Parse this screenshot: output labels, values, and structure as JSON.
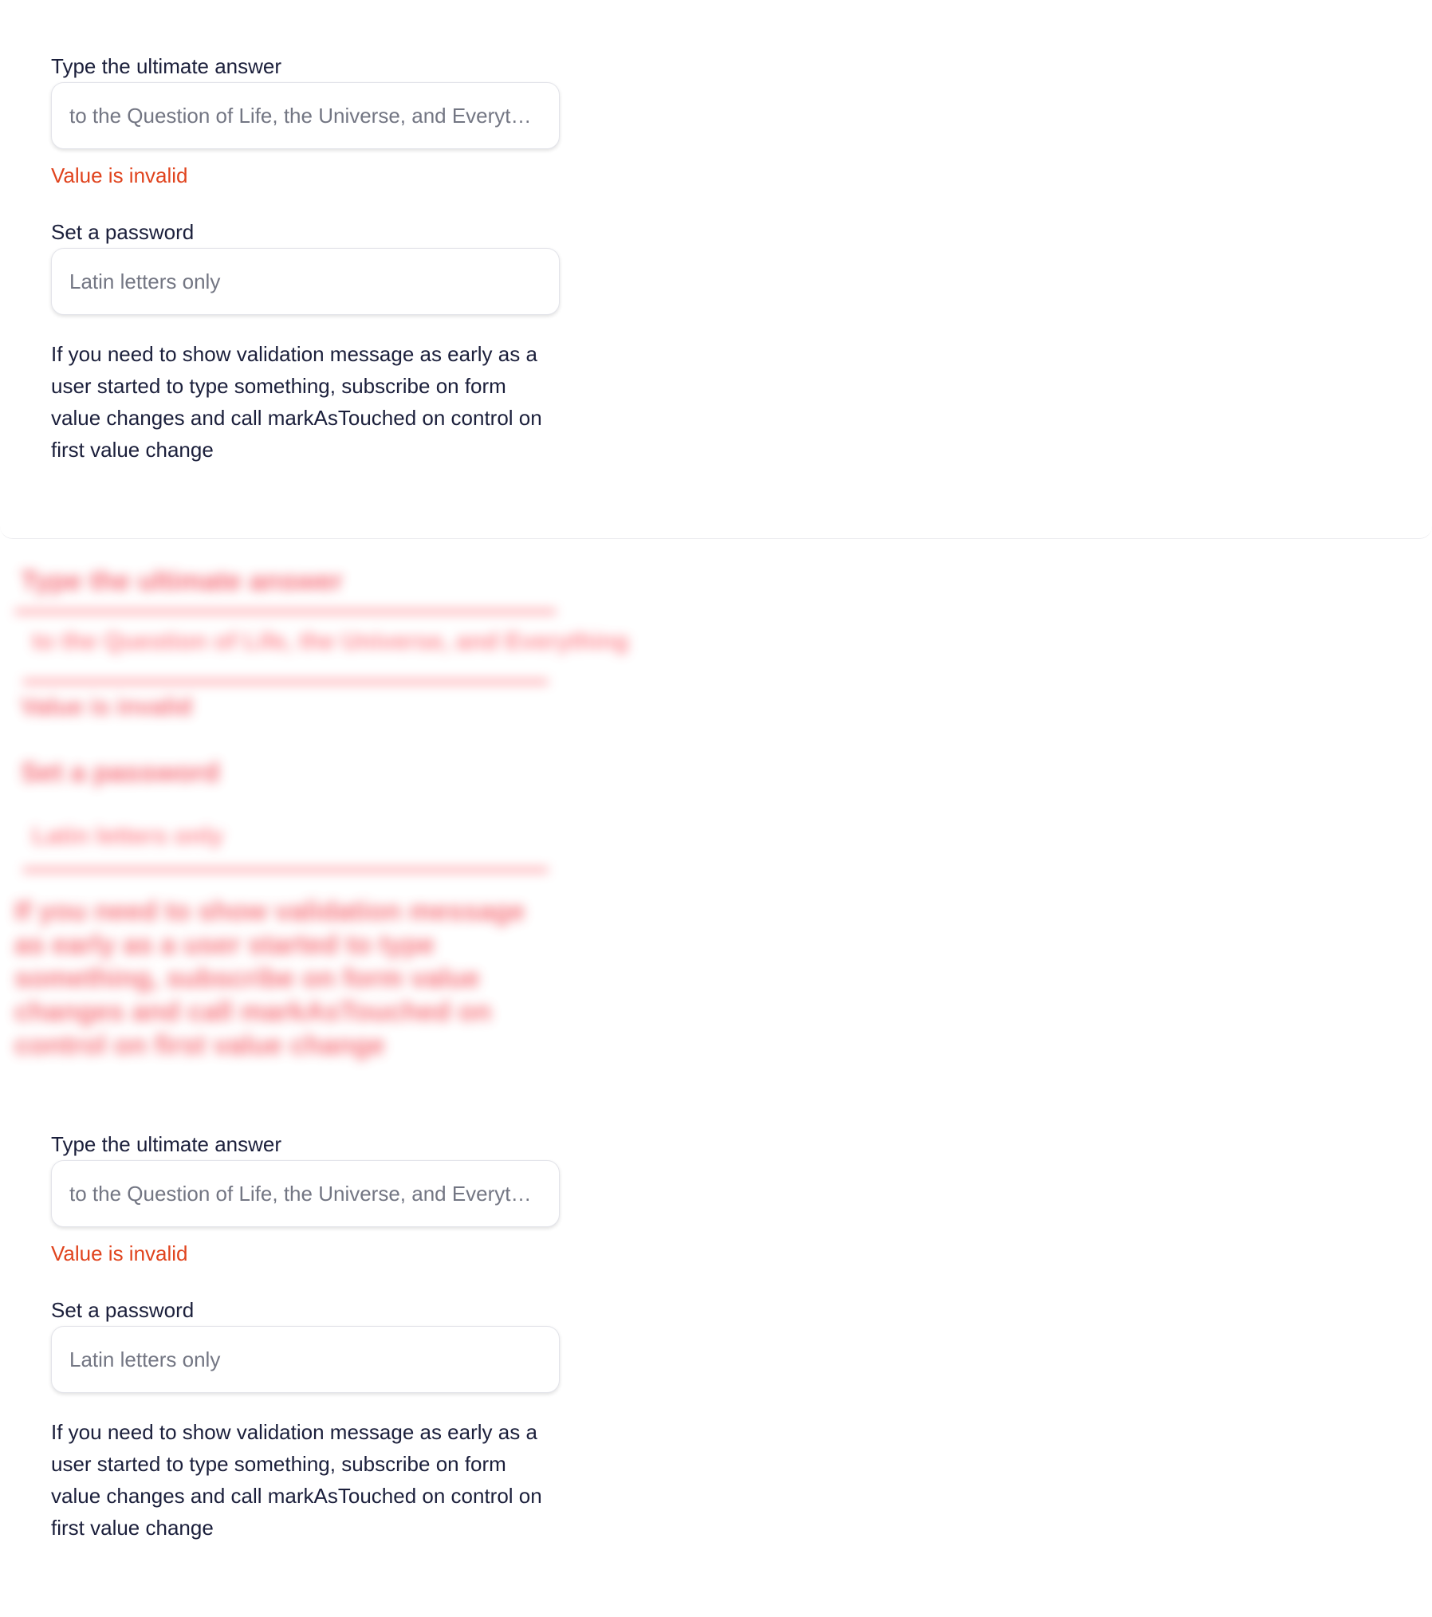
{
  "examples": [
    {
      "answer_field": {
        "label": "Type the ultimate answer",
        "placeholder": "to the Question of Life, the Universe, and Everything",
        "value": "",
        "error": "Value is invalid"
      },
      "password_field": {
        "label": "Set a password",
        "placeholder": "Latin letters only",
        "value": ""
      },
      "hint": "If you need to show validation message as early as a user started to type something, subscribe on form value changes and call markAsTouched on control on first value change"
    },
    {
      "answer_field": {
        "label": "Type the ultimate answer",
        "placeholder": "to the Question of Life, the Universe, and Everything",
        "value": "",
        "error": "Value is invalid"
      },
      "password_field": {
        "label": "Set a password",
        "placeholder": "Latin letters only",
        "value": ""
      },
      "hint": "If you need to show validation message as early as a user started to type something, subscribe on form value changes and call markAsTouched on control on first value change"
    }
  ],
  "colors": {
    "text": "#1b1f3b",
    "placeholder": "#737683",
    "error": "#e0431d",
    "field_border": "#e3e4ea",
    "blurred_tint": "#f23a49"
  }
}
